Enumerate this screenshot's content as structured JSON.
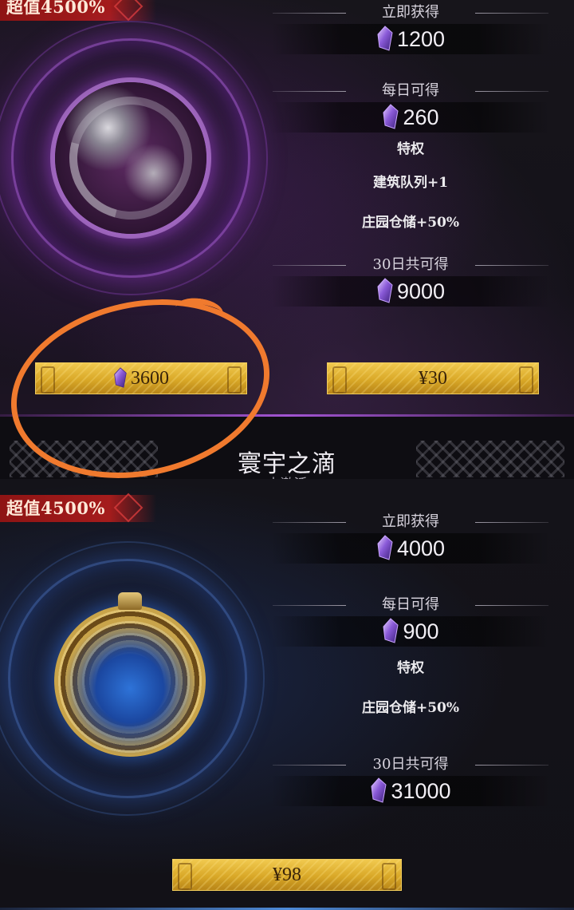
{
  "colors": {
    "ribbon": "#a51c1c",
    "gold_button": "#e0b23a",
    "annotation": "#f07a2e",
    "purple_accent": "#a254d2",
    "blue_accent": "#4e8ad8"
  },
  "icons": {
    "currency": "purple-crystal-icon"
  },
  "card1": {
    "ribbon": "超值4500%",
    "immediate_label": "立即获得",
    "immediate_value": "1200",
    "daily_label": "每日可得",
    "daily_value": "260",
    "privilege_label": "特权",
    "perks": [
      "建筑队列+1",
      "庄园仓储+50%"
    ],
    "total_label": "30日共可得",
    "total_value": "9000",
    "crystal_price": "3600",
    "cash_price": "¥30"
  },
  "section2": {
    "title": "寰宇之滴",
    "subtitle": "未激活"
  },
  "card2": {
    "ribbon": "超值4500%",
    "immediate_label": "立即获得",
    "immediate_value": "4000",
    "daily_label": "每日可得",
    "daily_value": "900",
    "privilege_label": "特权",
    "perks": [
      "庄园仓储+50%"
    ],
    "total_label": "30日共可得",
    "total_value": "31000",
    "cash_price": "¥98"
  }
}
